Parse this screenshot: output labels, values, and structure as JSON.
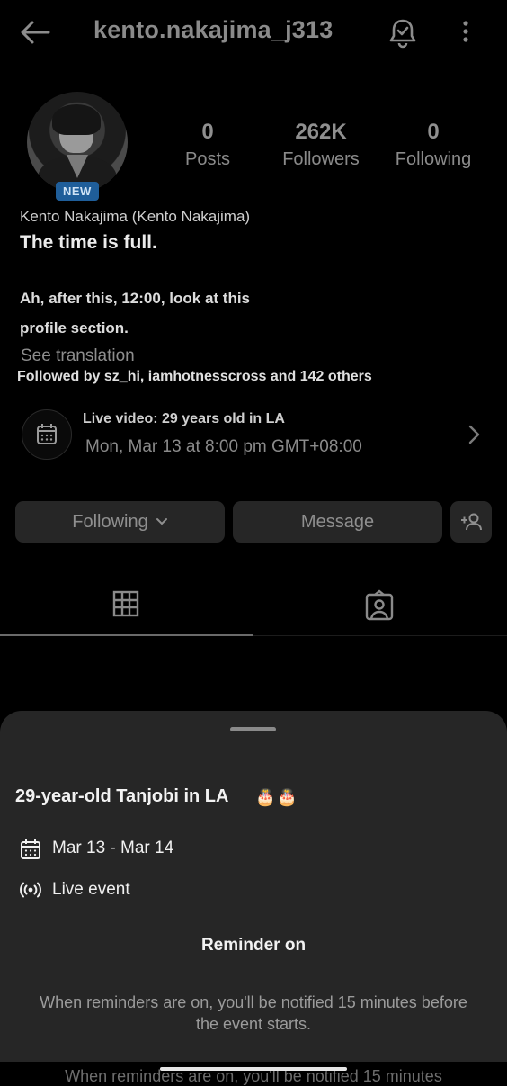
{
  "header": {
    "username": "kento.nakajima_j313",
    "back_icon": "back-arrow-icon",
    "bell_icon": "notification-bell-icon",
    "more_icon": "more-vertical-icon"
  },
  "profile": {
    "badge": "NEW",
    "stats": [
      {
        "value": "0",
        "label": "Posts"
      },
      {
        "value": "262K",
        "label": "Followers"
      },
      {
        "value": "0",
        "label": "Following"
      }
    ],
    "name": "Kento Nakajima (Kento Nakajima)",
    "bio_line1": "The time is full.",
    "bio_line2": "Ah, after this, 12:00, look at this",
    "bio_line3": "profile section.",
    "see_translation": "See translation",
    "followed_by": "Followed by sz_hi, iamhotnesscross and 142 others"
  },
  "live": {
    "title": "Live video: 29 years old in LA",
    "date": "Mon, Mar 13 at 8:00 pm GMT+08:00"
  },
  "actions": {
    "following": "Following",
    "message": "Message"
  },
  "sheet": {
    "title": "29-year-old Tanjobi in LA",
    "title_emoji": "🎂🎂",
    "dates": "Mar 13 - Mar 14",
    "event_type": "Live event",
    "reminder": "Reminder on",
    "note": "When reminders are on, you'll be notified 15 minutes before the event starts.",
    "cut_text": "When reminders are on, you'll be notified 15 minutes"
  },
  "colors": {
    "background": "#000000",
    "sheet": "#262626",
    "badge": "#1f5e9a"
  }
}
